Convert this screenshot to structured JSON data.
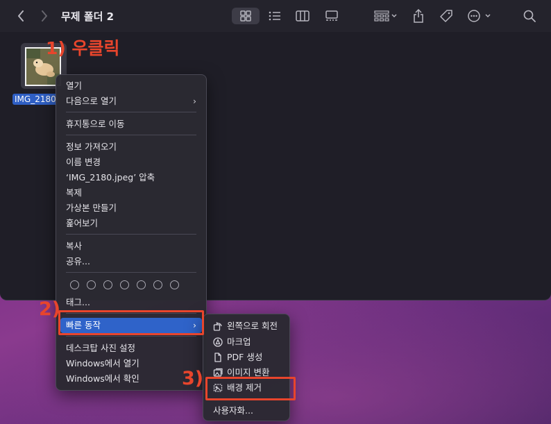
{
  "window": {
    "title": "무제 폴더 2"
  },
  "file": {
    "name": "IMG_2180"
  },
  "annotations": {
    "step1": "1) 우클릭",
    "step2": "2)",
    "step3": "3)"
  },
  "context_menu": {
    "open": "열기",
    "open_with": "다음으로 열기",
    "move_to_trash": "휴지통으로 이동",
    "get_info": "정보 가져오기",
    "rename": "이름 변경",
    "compress": "‘IMG_2180.jpeg’ 압축",
    "duplicate": "복제",
    "make_alias": "가상본 만들기",
    "quick_look": "훑어보기",
    "copy": "복사",
    "share": "공유...",
    "tags": "태그...",
    "quick_actions": "빠른 동작",
    "set_desktop_picture": "데스크탑 사진 설정",
    "open_in_windows": "Windows에서 열기",
    "show_in_windows": "Windows에서 확인"
  },
  "quick_actions_menu": {
    "rotate_left": "왼쪽으로 회전",
    "markup": "마크업",
    "create_pdf": "PDF 생성",
    "convert_image": "이미지 변환",
    "remove_background": "배경 제거",
    "customize": "사용자화..."
  },
  "colors": {
    "accent": "#2f63c9",
    "annotation": "#e8452c"
  }
}
